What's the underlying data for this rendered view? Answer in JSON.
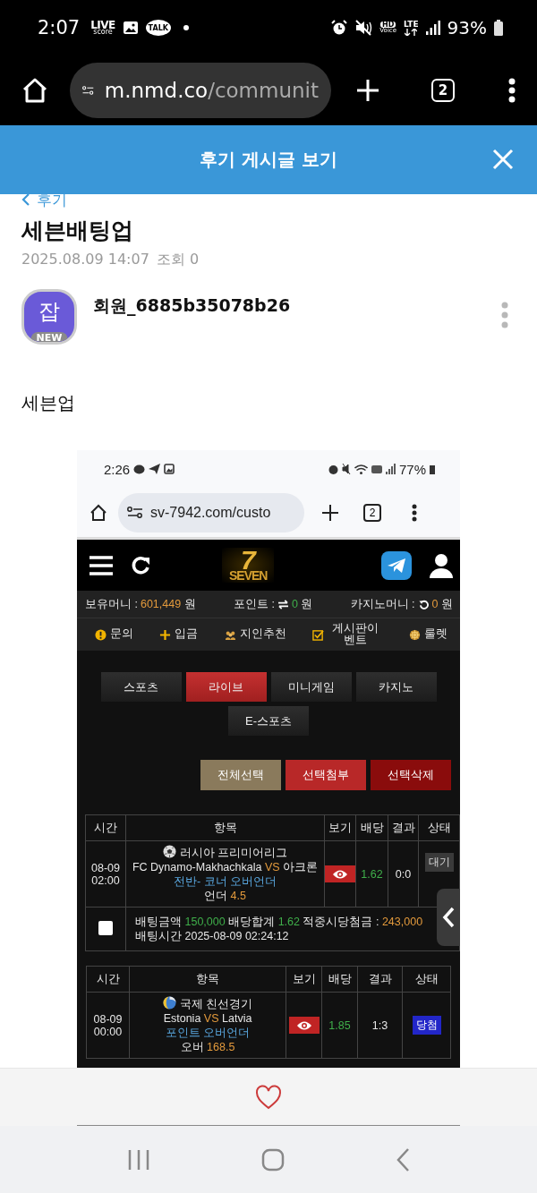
{
  "status_bar": {
    "time": "2:07",
    "live_badge": "LIVE",
    "live_badge_sub": "score",
    "talk_badge": "TALK",
    "hd_badge": "HD",
    "hd_badge_sub": "Voice",
    "network": "LTE",
    "battery": "93%"
  },
  "browser": {
    "url_host": "m.nmd.co",
    "url_path": "/communit",
    "tab_count": "2"
  },
  "header": {
    "title": "후기 게시글 보기"
  },
  "post": {
    "back_label": "후기",
    "title": "세븐배팅업",
    "date": "2025.08.09 14:07",
    "views": "조회 0",
    "author": {
      "avatar_char": "잡",
      "badge": "NEW",
      "name": "회원_6885b35078b26"
    },
    "body": "세븐업"
  },
  "shot": {
    "status": {
      "time": "2:26",
      "battery": "77%"
    },
    "browser": {
      "url": "sv-7942.com/custo",
      "tab_count": "2"
    },
    "site": {
      "logo_numeral": "7",
      "logo_word": "SEVEN",
      "balances": [
        {
          "label": "보유머니 :",
          "kind": "plain",
          "value": "601,449",
          "unit": "원",
          "color": "#e39a3c"
        },
        {
          "label": "포인트 :",
          "kind": "transfer",
          "value": "0",
          "unit": "원",
          "color": "#3fae4a"
        },
        {
          "label": "카지노머니 :",
          "kind": "refresh",
          "value": "0",
          "unit": "원",
          "color": "#e39a3c"
        }
      ],
      "menu": [
        {
          "kind": "info",
          "label": "문의"
        },
        {
          "kind": "plus",
          "label": "입금"
        },
        {
          "kind": "people",
          "label": "지인추천"
        },
        {
          "kind": "check",
          "label": "게시판이벤트"
        },
        {
          "kind": "wheel",
          "label": "룰렛"
        }
      ],
      "tabs": [
        {
          "label": "스포츠",
          "selected": false
        },
        {
          "label": "라이브",
          "selected": true
        },
        {
          "label": "미니게임",
          "selected": false
        },
        {
          "label": "카지노",
          "selected": false
        },
        {
          "label": "E-스포츠",
          "selected": false
        }
      ],
      "actions": [
        {
          "kind": "select_all",
          "label": "전체선택"
        },
        {
          "kind": "attach",
          "label": "선택첨부"
        },
        {
          "kind": "delete",
          "label": "선택삭제"
        }
      ],
      "bets": [
        {
          "columns": [
            "시간",
            "항목",
            "보기",
            "배당",
            "결과",
            "상태"
          ],
          "rows": [
            {
              "date": "08-09",
              "time": "02:00",
              "kind": "soccer",
              "league": "러시아 프리미어리그",
              "home": "FC Dynamo-Makhachkala",
              "vs": "VS",
              "away": "아크론",
              "market": "전반- 코너 오버언더",
              "pick": "언더",
              "line": "4.5",
              "odds": "1.62",
              "score": "0:0",
              "status": {
                "label": "대기",
                "kind": "pending"
              }
            }
          ],
          "summary": {
            "checked": false,
            "amount_label": "배팅금액",
            "amount": "150,000",
            "total_label": "배당합계",
            "total": "1.62",
            "payout_label": "적중시당첨금 :",
            "payout": "243,000",
            "time_label": "배팅시간 2025-08-09 02:24:12"
          }
        },
        {
          "columns": [
            "시간",
            "항목",
            "보기",
            "배당",
            "결과",
            "상태"
          ],
          "rows": [
            {
              "date": "08-09",
              "time": "00:00",
              "kind": "international",
              "league": "국제 친선경기",
              "home": "Estonia",
              "vs": "VS",
              "away": "Latvia",
              "market": "포인트 오버언더",
              "pick": "오버",
              "line": "168.5",
              "odds": "1.85",
              "score": "1:3",
              "status": {
                "label": "당첨",
                "kind": "won"
              }
            }
          ]
        }
      ]
    }
  }
}
